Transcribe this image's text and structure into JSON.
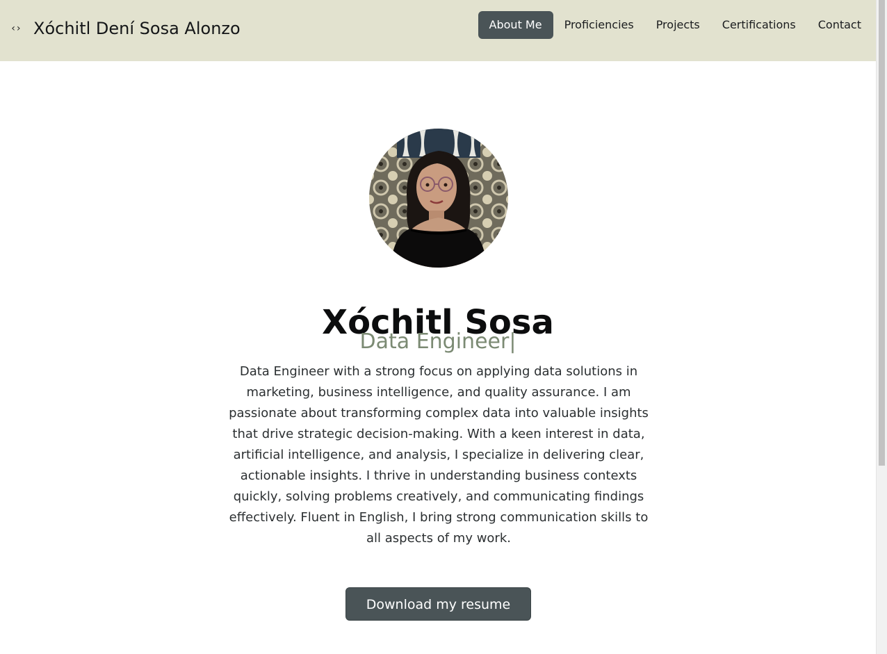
{
  "header": {
    "brand_icon": "‹›",
    "brand_name": "Xóchitl Dení Sosa Alonzo",
    "nav": [
      {
        "label": "About Me",
        "active": true
      },
      {
        "label": "Proficiencies",
        "active": false
      },
      {
        "label": "Projects",
        "active": false
      },
      {
        "label": "Certifications",
        "active": false
      },
      {
        "label": "Contact",
        "active": false
      }
    ]
  },
  "hero": {
    "name": "Xóchitl Sosa",
    "role": "Data Engineer|",
    "bio": "Data Engineer with a strong focus on applying data solutions in marketing, business intelligence, and quality assurance. I am passionate about transforming complex data into valuable insights that drive strategic decision-making. With a keen interest in data, artificial intelligence, and analysis, I specialize in delivering clear, actionable insights. I thrive in understanding business contexts quickly, solving problems creatively, and communicating findings effectively. Fluent in English, I bring strong communication skills to all aspects of my work.",
    "resume_button": "Download my resume"
  },
  "colors": {
    "navbar_bg": "#e2e2cf",
    "accent_button": "#4a5457",
    "role_text": "#7b8a73"
  },
  "icons": {
    "brand": "code-icon"
  }
}
